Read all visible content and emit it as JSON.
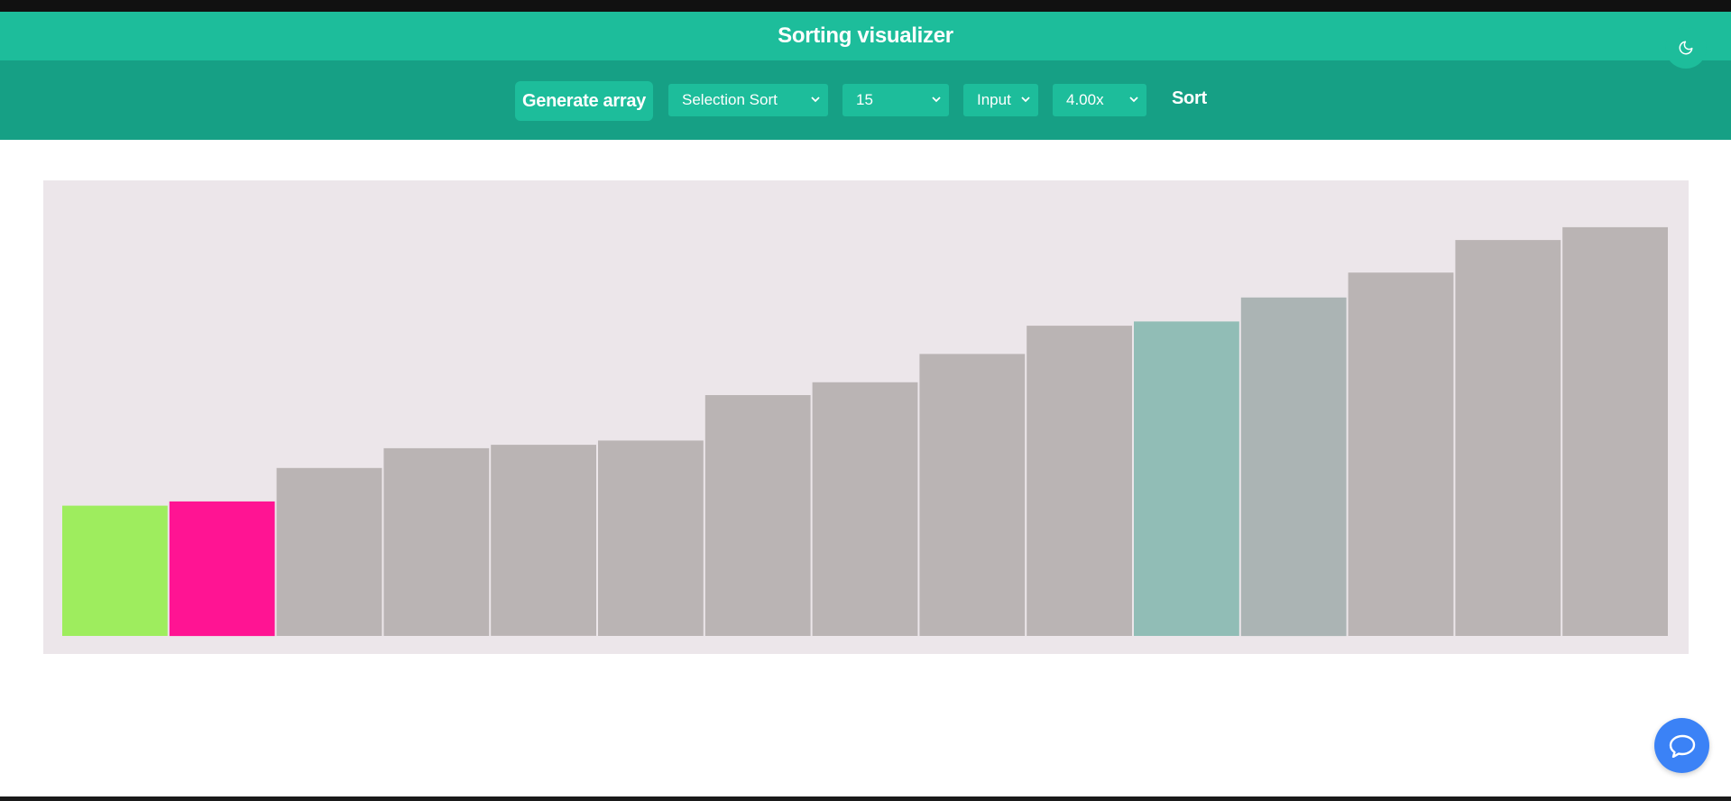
{
  "header": {
    "title": "Sorting visualizer"
  },
  "toolbar": {
    "generate_label": "Generate array",
    "algorithm_select": {
      "selected": "Selection Sort"
    },
    "size_select": {
      "selected": "15"
    },
    "input_select": {
      "selected": "Input"
    },
    "speed_select": {
      "selected": "4.00x"
    },
    "sort_label": "Sort"
  },
  "icons": {
    "theme_toggle": "moon-icon",
    "chevron": "chevron-down-icon",
    "chat": "chat-bubble-icon"
  },
  "colors": {
    "header_bg": "#1dbd9b",
    "toolbar_bg": "#16a085",
    "bar_default": "#bab4b4",
    "bar_sorted": "#9eed5e",
    "bar_current": "#ff1493",
    "bar_compare": "#91bdb6",
    "bar_light": "#abb4b4",
    "chart_bg": "#ece6ea",
    "chat_button": "#3b82f6"
  },
  "chart_data": {
    "type": "bar",
    "values": [
      152,
      157,
      196,
      219,
      223,
      228,
      281,
      296,
      329,
      362,
      367,
      395,
      424,
      462,
      477
    ],
    "ylim": [
      0,
      500
    ],
    "bar_states": [
      "sorted",
      "current",
      "default",
      "default",
      "default",
      "default",
      "default",
      "default",
      "default",
      "default",
      "compare",
      "light",
      "default",
      "default",
      "default"
    ]
  }
}
